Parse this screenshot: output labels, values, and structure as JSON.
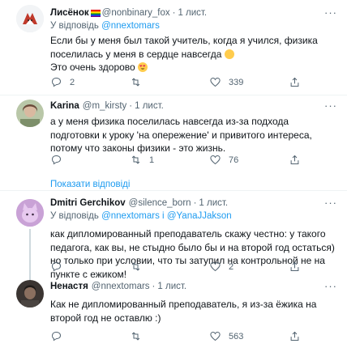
{
  "tweets": [
    {
      "name": "Лисёнок",
      "handle": "@nonbinary_fox",
      "dot": "·",
      "time": "1 лист.",
      "reply_prefix": "У відповідь",
      "reply_to": "@nnextomars",
      "text": "Если бы у меня был такой учитель, когда я учился, физика поселилась у меня в сердце навсегда",
      "text2": "Это очень здорово",
      "replies": "2",
      "retweets": "",
      "likes": "339"
    },
    {
      "name": "Karina",
      "handle": "@m_kirsty",
      "dot": "·",
      "time": "1 лист.",
      "text": "а у меня физика поселилась навсегда из-за подхода подготовки к уроку 'на опережение'  и  привитого  интереса, потому что законы физики - это жизнь.",
      "replies": "",
      "retweets": "1",
      "likes": "76"
    },
    {
      "name": "Dmitri Gerchikov",
      "handle": "@silence_born",
      "dot": "·",
      "time": "1 лист.",
      "reply_prefix": "У відповідь",
      "reply_to": "@nnextomars",
      "reply_and": "і",
      "reply_to2": "@YanaJJakson",
      "text": "как дипломированный преподаватель скажу честно: у такого педагога, как вы, не стыдно было бы и на второй год остаться) но только при условии, что ты затупил на контрольной не на пункте с ежиком!",
      "replies": "",
      "retweets": "",
      "likes": "2"
    },
    {
      "name": "Ненастя",
      "handle": "@nnextomars",
      "dot": "·",
      "time": "1 лист.",
      "text": "Как не дипломированный преподаватель, я из-за ёжика на второй год не оставлю :)",
      "replies": "",
      "retweets": "",
      "likes": "563"
    }
  ],
  "show_replies_label": "Показати відповіді",
  "more_glyph": "···",
  "colors": {
    "accent": "#1d9bf0",
    "secondary_text": "#536471",
    "divider": "#eff3f4"
  }
}
